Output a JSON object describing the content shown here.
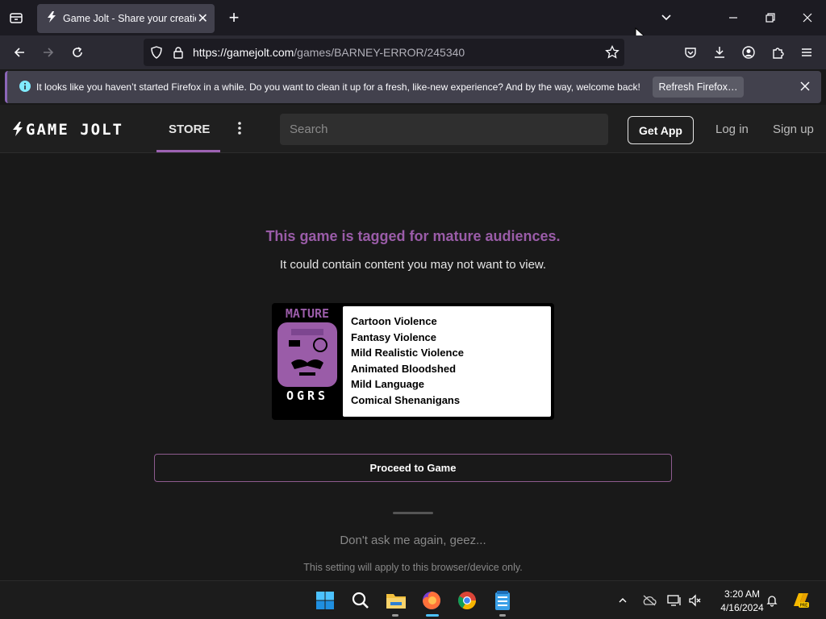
{
  "browser": {
    "tab": {
      "title": "Game Jolt - Share your creations",
      "close_glyph": "✕"
    },
    "new_tab_glyph": "+",
    "url": {
      "host": "https://gamejolt.com",
      "path": "/games/BARNEY-ERROR/245340"
    },
    "notification": {
      "text": "It looks like you haven’t started Firefox in a while. Do you want to clean it up for a fresh, like-new experience? And by the way, welcome back!",
      "button_label": "Refresh Firefox…"
    }
  },
  "site": {
    "logo": "GAME JOLT",
    "nav": {
      "store": "STORE"
    },
    "search_placeholder": "Search",
    "get_app": "Get App",
    "login": "Log in",
    "signup": "Sign up"
  },
  "gate": {
    "title": "This game is tagged for mature audiences.",
    "subtitle": "It could contain content you may not want to view.",
    "rating": {
      "badge_top": "MATURE",
      "badge_bottom": "OGRS",
      "descriptors": [
        "Cartoon Violence",
        "Fantasy Violence",
        "Mild Realistic Violence",
        "Animated Bloodshed",
        "Mild Language",
        "Comical Shenanigans"
      ]
    },
    "proceed_label": "Proceed to Game",
    "dont_ask_label": "Don't ask me again, geez...",
    "setting_note": "This setting will apply to this browser/device only."
  },
  "taskbar": {
    "time": "3:20 AM",
    "date": "4/16/2024"
  },
  "colors": {
    "accent_purple": "#9a5ca8",
    "firefox_tab": "#42414d",
    "page_bg": "#191919"
  }
}
